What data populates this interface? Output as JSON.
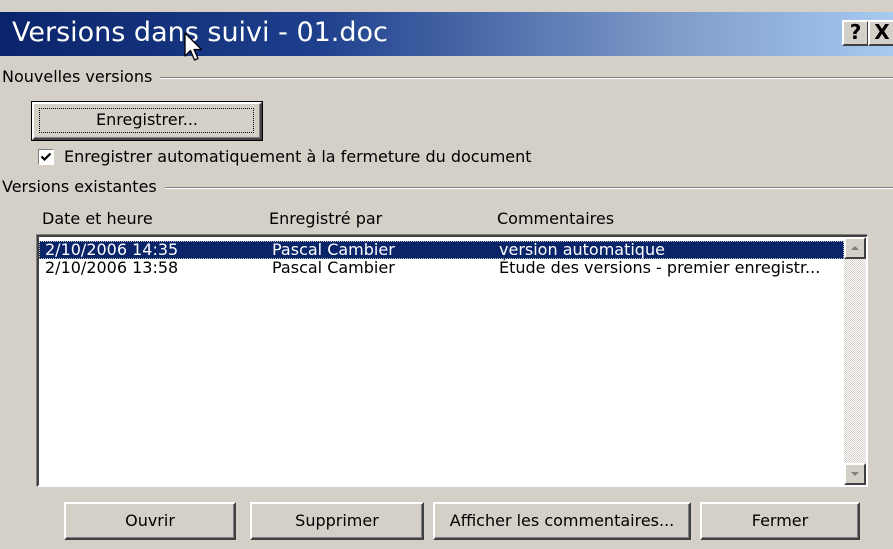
{
  "window": {
    "title": "Versions dans suivi - 01.doc",
    "help_label": "?",
    "close_label": "X",
    "titlebar_colors": [
      "#0a246a",
      "#a6caf0"
    ]
  },
  "new_versions": {
    "header": "Nouvelles versions",
    "save_button": "Enregistrer...",
    "autosave_checkbox": {
      "label": "Enregistrer automatiquement à la fermeture du document",
      "checked": true
    }
  },
  "existing_versions": {
    "header": "Versions existantes",
    "columns": [
      "Date et heure",
      "Enregistré par",
      "Commentaires"
    ],
    "rows": [
      {
        "date": "2/10/2006 14:35",
        "author": "Pascal Cambier",
        "comment": "version automatique",
        "selected": true
      },
      {
        "date": "2/10/2006 13:58",
        "author": "Pascal Cambier",
        "comment": "Étude des versions - premier enregistr...",
        "selected": false
      }
    ],
    "selection_color": "#0a246a"
  },
  "footer_buttons": {
    "open": "Ouvrir",
    "delete": "Supprimer",
    "view_comments": "Afficher les commentaires...",
    "close": "Fermer"
  },
  "icons": {
    "checkbox_mark": "checkmark-icon",
    "scroll_up": "arrow-up-icon",
    "scroll_down": "arrow-down-icon",
    "pointer": "mouse-pointer-icon"
  }
}
